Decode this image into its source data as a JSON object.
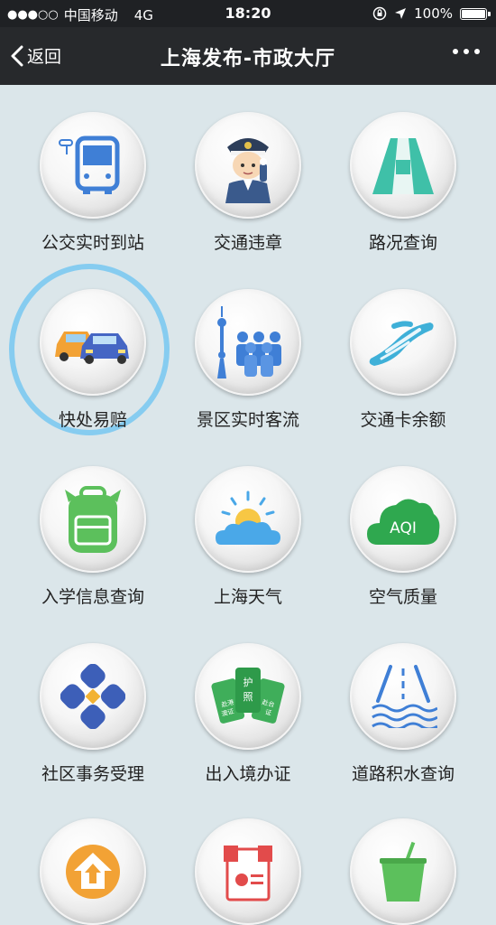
{
  "status_bar": {
    "carrier": "中国移动",
    "network": "4G",
    "time": "18:20",
    "battery": "100%",
    "battery_level": 1.0,
    "icons": [
      "signal-dots-icon",
      "rotation-lock-icon",
      "location-arrow-icon",
      "battery-icon"
    ]
  },
  "navbar": {
    "back_label": "返回",
    "title": "上海发布-市政大厅",
    "more_icon": "more-dots-icon"
  },
  "services": [
    {
      "label": "公交实时到站",
      "icon": "bus-icon"
    },
    {
      "label": "交通违章",
      "icon": "traffic-police-icon"
    },
    {
      "label": "路况查询",
      "icon": "road-icon"
    },
    {
      "label": "快处易赔",
      "icon": "cars-icon",
      "highlighted": true
    },
    {
      "label": "景区实时客流",
      "icon": "crowd-tower-icon"
    },
    {
      "label": "交通卡余额",
      "icon": "transport-card-icon"
    },
    {
      "label": "入学信息查询",
      "icon": "backpack-icon"
    },
    {
      "label": "上海天气",
      "icon": "weather-icon"
    },
    {
      "label": "空气质量",
      "icon": "aqi-cloud-icon",
      "icon_text": "AQI"
    },
    {
      "label": "社区事务受理",
      "icon": "community-icon"
    },
    {
      "label": "出入境办证",
      "icon": "passport-cards-icon",
      "icon_texts": [
        "护照",
        "赴港澳证",
        "赴台证"
      ]
    },
    {
      "label": "道路积水查询",
      "icon": "road-water-icon"
    },
    {
      "label": "",
      "icon": "home-up-icon"
    },
    {
      "label": "",
      "icon": "certificate-icon"
    },
    {
      "label": "",
      "icon": "drink-icon"
    }
  ],
  "colors": {
    "statusbar_bg": "#1f2124",
    "navbar_bg": "#27292c",
    "page_bg": "#dbe6ea",
    "highlight_ring": "#86ccf0",
    "icon_blue": "#3f7fd6",
    "icon_teal": "#3fc0a8",
    "icon_green": "#5cc05c"
  }
}
